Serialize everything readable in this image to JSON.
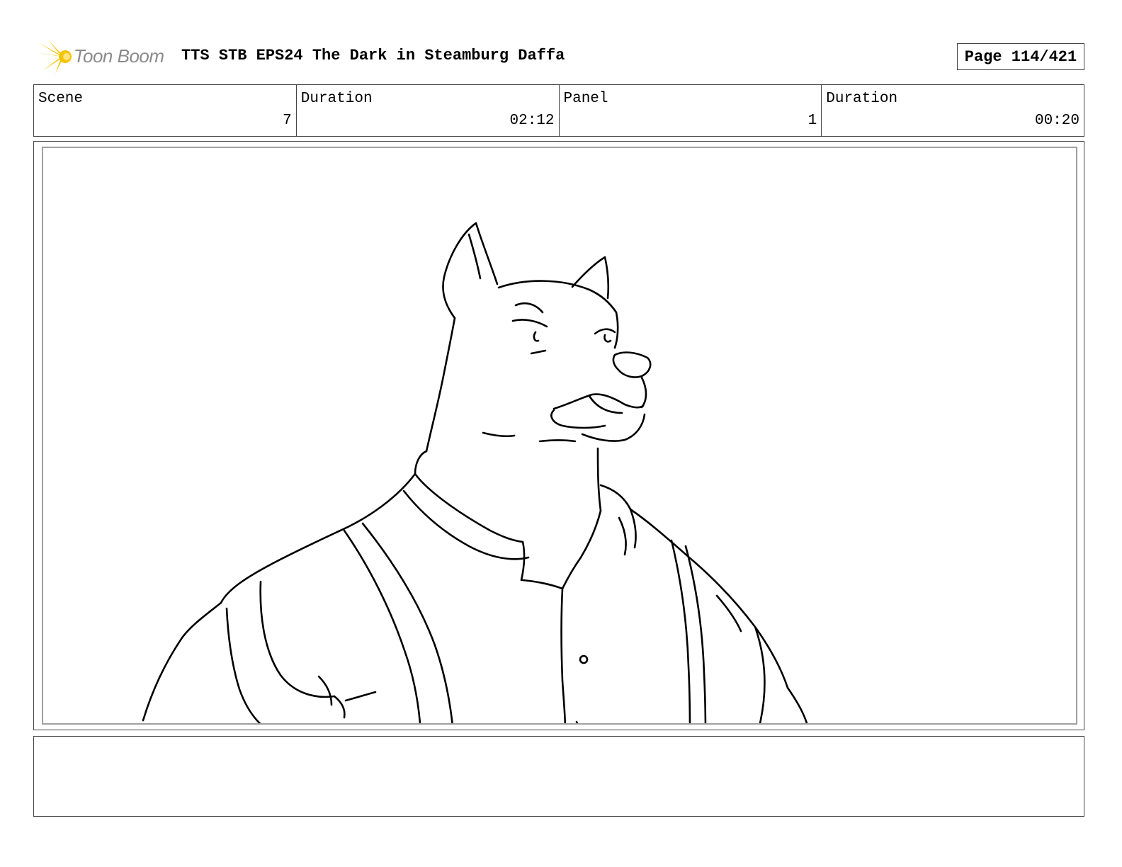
{
  "header": {
    "logo_text": "Toon Boom",
    "title": "TTS STB EPS24 The Dark in Steamburg Daffa",
    "page": "Page 114/421"
  },
  "info": {
    "scene_label": "Scene",
    "scene_value": "7",
    "scene_duration_label": "Duration",
    "scene_duration_value": "02:12",
    "panel_label": "Panel",
    "panel_value": "1",
    "panel_duration_label": "Duration",
    "panel_duration_value": "00:20"
  },
  "colors": {
    "logo_burst": "#f5c400",
    "logo_text": "#8a8a8a",
    "frame_border": "#a0a0a0"
  }
}
